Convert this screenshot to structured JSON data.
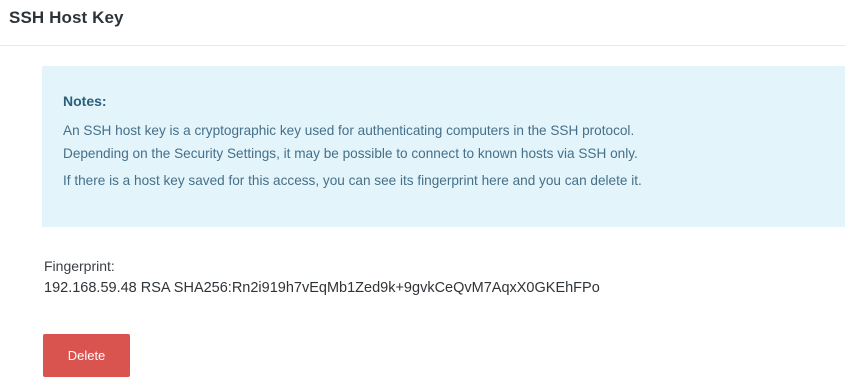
{
  "section": {
    "title": "SSH Host Key"
  },
  "notes": {
    "title": "Notes:",
    "line1": "An SSH host key is a cryptographic key used for authenticating computers in the SSH protocol.",
    "line2": "Depending on the Security Settings, it may be possible to connect to known hosts via SSH only.",
    "line3": "If there is a host key saved for this access, you can see its fingerprint here and you can delete it."
  },
  "fingerprint": {
    "label": "Fingerprint:",
    "value": "192.168.59.48 RSA SHA256:Rn2i919h7vEqMb1Zed9k+9gvkCeQvM7AqxX0GKEhFPo"
  },
  "actions": {
    "delete_label": "Delete"
  },
  "colors": {
    "notes_background": "#e3f4fb",
    "notes_text": "#45708a",
    "delete_button": "#d9534f"
  }
}
